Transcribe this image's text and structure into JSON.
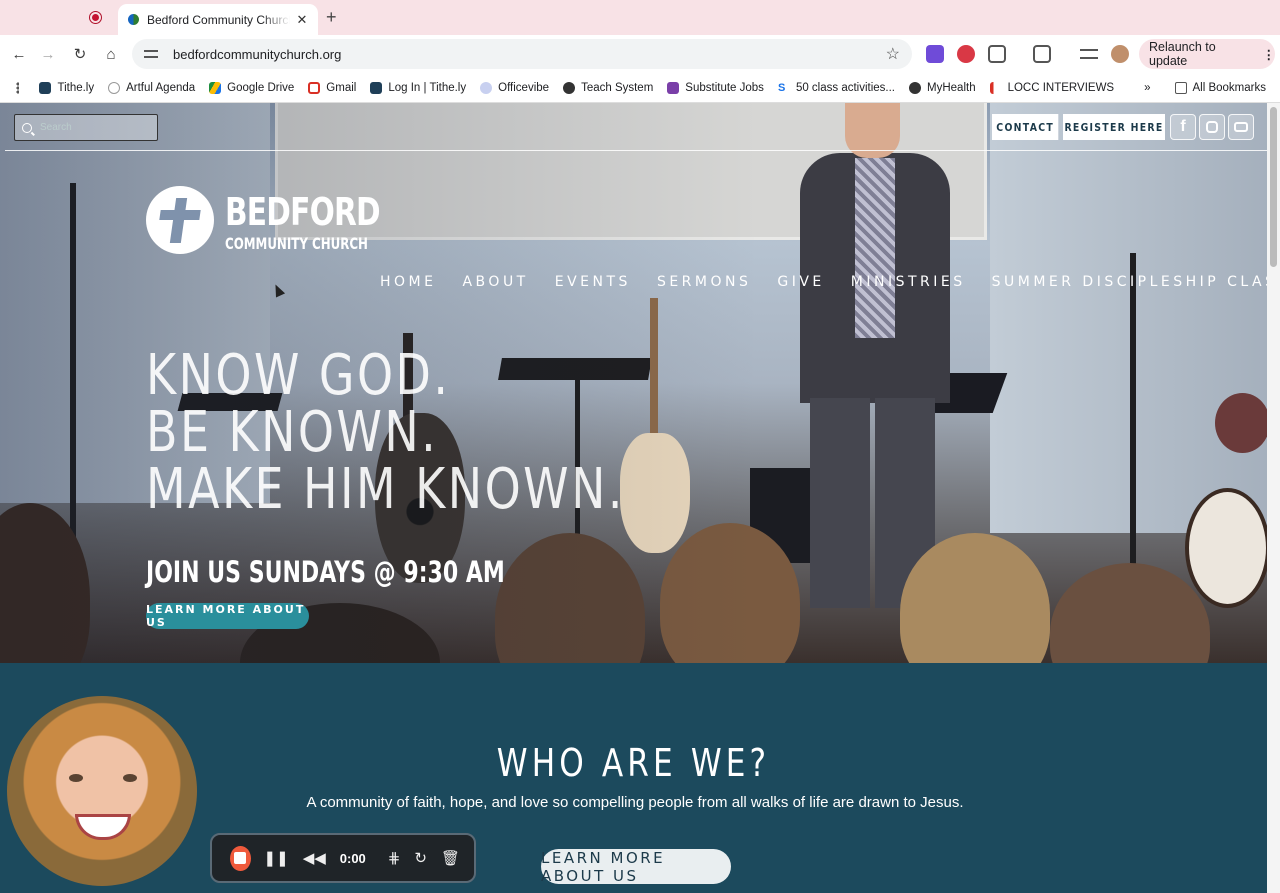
{
  "browser": {
    "tab_title": "Bedford Community Church",
    "url": "bedfordcommunitychurch.org",
    "relaunch_label": "Relaunch to update",
    "bookmarks": [
      "Tithe.ly",
      "Artful Agenda",
      "Google Drive",
      "Gmail",
      "Log In | Tithe.ly",
      "Officevibe",
      "Teach System",
      "Substitute Jobs",
      "50 class activities...",
      "MyHealth",
      "LOCC INTERVIEWS"
    ],
    "all_bookmarks_label": "All Bookmarks"
  },
  "header": {
    "search_placeholder": "Search",
    "contact_label": "CONTACT",
    "register_label": "REGISTER HERE"
  },
  "logo": {
    "name": "BEDFORD",
    "sub": "COMMUNITY CHURCH"
  },
  "nav": [
    "HOME",
    "ABOUT",
    "EVENTS",
    "SERMONS",
    "GIVE",
    "MINISTRIES",
    "SUMMER DISCIPLESHIP CLASSES"
  ],
  "hero": {
    "line1": "KNOW GOD.",
    "line2": "BE KNOWN.",
    "line3": "MAKE HIM KNOWN.",
    "join": "JOIN US SUNDAYS @ 9:30 AM",
    "button": "LEARN MORE ABOUT US"
  },
  "who": {
    "title": "WHO ARE WE?",
    "text": "A community of faith, hope, and love so compelling people from all walks of life are drawn to Jesus.",
    "button": "LEARN MORE ABOUT US"
  },
  "recorder": {
    "time": "0:00"
  }
}
